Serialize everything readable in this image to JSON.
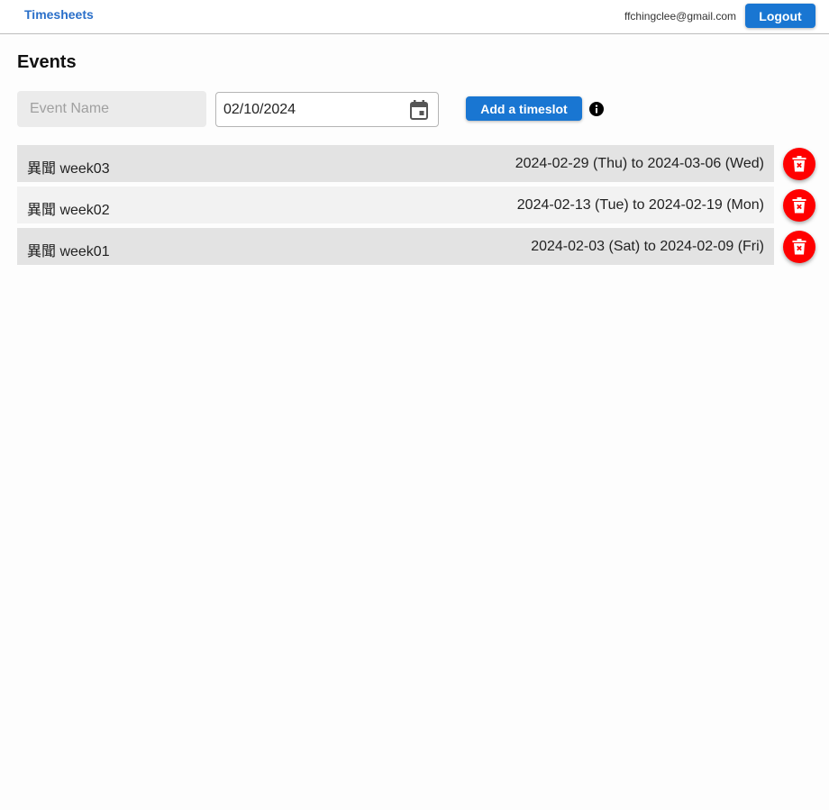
{
  "header": {
    "brand": "Timesheets",
    "user_email": "ffchingclee@gmail.com",
    "logout_label": "Logout"
  },
  "main": {
    "title": "Events",
    "event_name_placeholder": "Event Name",
    "date_value": "02/10/2024",
    "add_label": "Add a timeslot",
    "events": [
      {
        "name": "異聞 week03",
        "range": "2024-02-29 (Thu) to 2024-03-06 (Wed)"
      },
      {
        "name": "異聞 week02",
        "range": "2024-02-13 (Tue) to 2024-02-19 (Mon)"
      },
      {
        "name": "異聞 week01",
        "range": "2024-02-03 (Sat) to 2024-02-09 (Fri)"
      }
    ]
  },
  "icons": {
    "calendar": "calendar-icon",
    "info": "info-icon",
    "delete": "trash-icon"
  },
  "colors": {
    "primary": "#1976d2",
    "brand_text": "#2a6fc9",
    "delete": "#ff0000"
  }
}
